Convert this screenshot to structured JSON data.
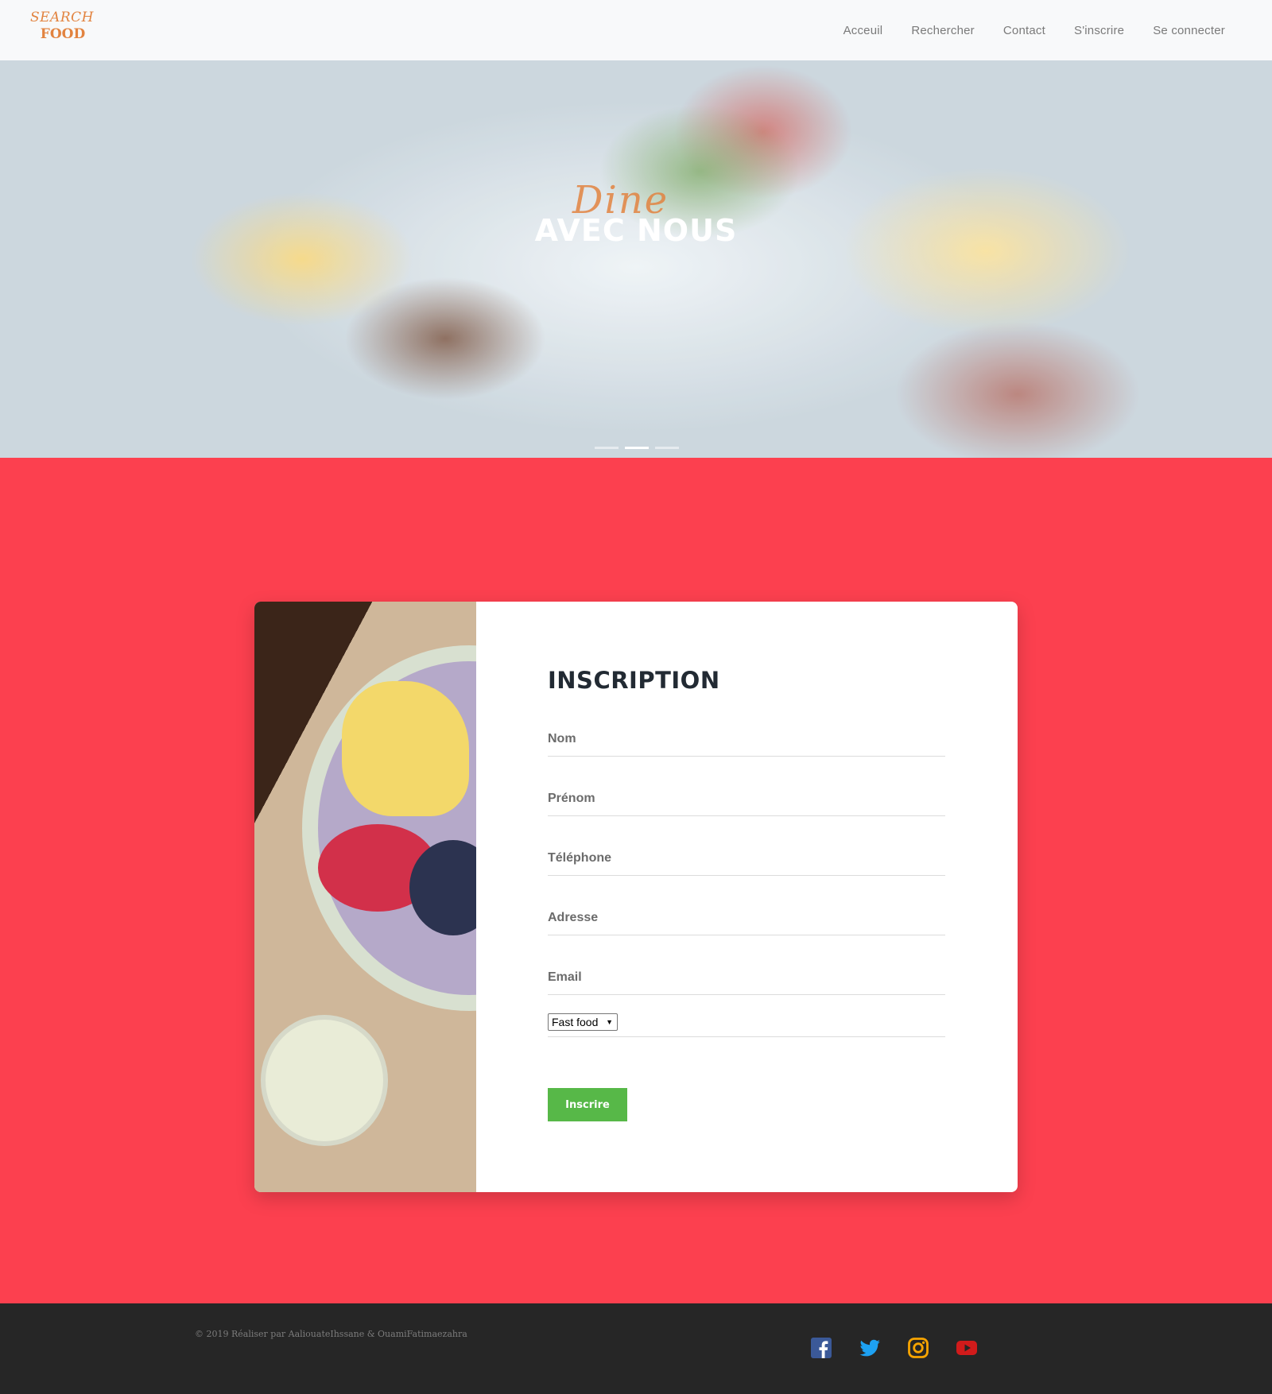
{
  "navbar": {
    "logo": {
      "line1": "SEARCH",
      "line2": "FOOD"
    },
    "links": [
      "Acceuil",
      "Rechercher",
      "Contact",
      "S'inscrire",
      "Se connecter"
    ]
  },
  "hero": {
    "script_text": "Dine",
    "title": "AVEC NOUS",
    "slide_count": 3,
    "active_slide": 2
  },
  "form": {
    "title": "INSCRIPTION",
    "fields": [
      {
        "placeholder": "Nom"
      },
      {
        "placeholder": "Prénom"
      },
      {
        "placeholder": "Téléphone"
      },
      {
        "placeholder": "Adresse"
      },
      {
        "placeholder": "Email"
      }
    ],
    "category": {
      "selected": "Fast food"
    },
    "submit_label": "Inscrire"
  },
  "footer": {
    "copyright": "© 2019 Réaliser par AaliouateIhssane & OuamiFatimaezahra",
    "socials": [
      {
        "icon": "facebook-icon",
        "color": "#3b5998"
      },
      {
        "icon": "twitter-icon",
        "color": "#1da1f2"
      },
      {
        "icon": "instagram-icon",
        "color": "#f7a400"
      },
      {
        "icon": "youtube-icon",
        "color": "#d11b1b"
      }
    ]
  },
  "colors": {
    "background": "#fc404f",
    "navbar": "#f8f9fa",
    "button": "#57b848",
    "footer": "#262626",
    "logo": "#e2833f"
  }
}
